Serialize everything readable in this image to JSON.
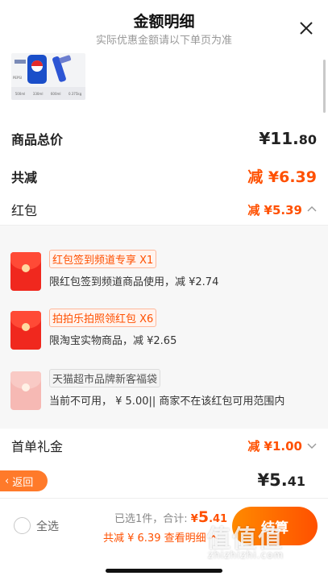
{
  "header": {
    "title": "金额明细",
    "subtitle": "实际优惠金额请以下单页为准"
  },
  "product": {
    "brand_text": "PEPSI",
    "spec_cells": [
      "500ml",
      "330ml",
      "600ml",
      "0.375kg"
    ]
  },
  "summary": {
    "total_label": "商品总价",
    "total_int": "¥11.",
    "total_dec": "80",
    "reduce_label": "共减",
    "reduce_value": "减 ¥6.39",
    "hongbao_label": "红包",
    "hongbao_value": "减 ¥5.39"
  },
  "coupons": [
    {
      "tag": "红包签到频道专享 X1",
      "desc": "限红包签到频道商品使用，减 ¥2.74",
      "enabled": true
    },
    {
      "tag": "拍拍乐拍照领红包 X6",
      "desc": "限淘宝实物商品，减 ¥2.65",
      "enabled": true
    },
    {
      "tag": "天猫超市品牌新客福袋",
      "desc": "当前不可用， ¥ 5.00|| 商家不在该红包可用范围内",
      "enabled": false
    }
  ],
  "gift": {
    "label": "首单礼金",
    "value": "减 ¥1.00"
  },
  "final": {
    "back_label": "返回",
    "int": "¥5.",
    "dec": "41"
  },
  "bottom": {
    "select_all": "全选",
    "selected_prefix": "已选1件，合计: ",
    "amount_symbol": "¥",
    "amount_big": "5",
    "amount_small": ".41",
    "detail_text": "共减 ¥ 6.39 查看明细",
    "checkout": "结算"
  },
  "watermark": {
    "text": "值值值",
    "site": "zhizhizhi.com"
  },
  "colors": {
    "accent": "#ff5000",
    "envelope": "#f0281e"
  }
}
